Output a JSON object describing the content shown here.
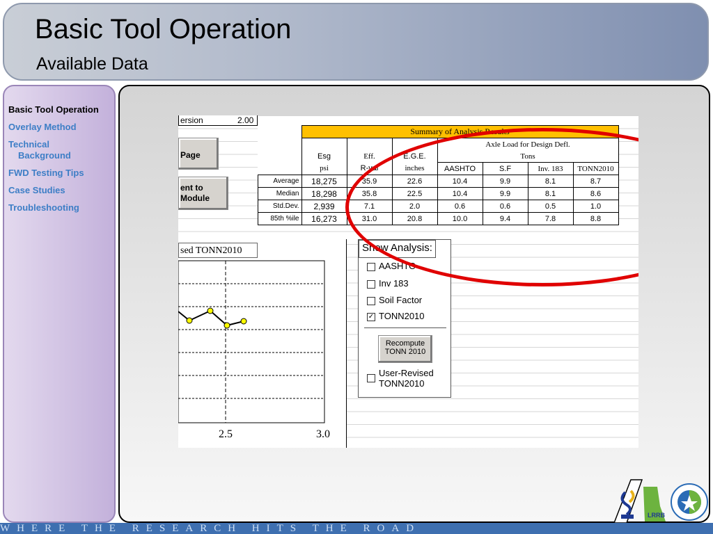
{
  "header": {
    "title": "Basic Tool Operation",
    "subtitle": "Available Data"
  },
  "sidebar": {
    "items": [
      {
        "label": "Basic Tool Operation",
        "active": true
      },
      {
        "label": "Overlay Method"
      },
      {
        "label": "Technical",
        "label2": "Background"
      },
      {
        "label": "FWD Testing Tips"
      },
      {
        "label": "Case Studies"
      },
      {
        "label": "Troubleshooting"
      }
    ]
  },
  "sheet": {
    "version_label": "ersion",
    "version_value": "2.00",
    "page_button": "Page",
    "module_button_line1": "ent to",
    "module_button_line2": "Module",
    "summary": {
      "band": "Summary of Analysis Results",
      "axle_header_line1": "Axle Load for Design Defl.",
      "axle_header_line2": "Tons",
      "col_names": [
        "Esg",
        "Eff.",
        "E.G.E."
      ],
      "col_units": [
        "psi",
        "R-val",
        "inches"
      ],
      "sub_cols": [
        "AASHTO",
        "S.F",
        "Inv. 183",
        "TONN2010"
      ],
      "rows": [
        {
          "label": "Average",
          "values": [
            "18,275",
            "35.9",
            "22.6",
            "10.4",
            "9.9",
            "8.1",
            "8.7"
          ]
        },
        {
          "label": "Median",
          "values": [
            "18,298",
            "35.8",
            "22.5",
            "10.4",
            "9.9",
            "8.1",
            "8.6"
          ]
        },
        {
          "label": "Std.Dev.",
          "values": [
            "2,939",
            "7.1",
            "2.0",
            "0.6",
            "0.6",
            "0.5",
            "1.0"
          ]
        },
        {
          "label": "85th %ile",
          "values": [
            "16,273",
            "31.0",
            "20.8",
            "10.0",
            "9.4",
            "7.8",
            "8.8"
          ]
        }
      ]
    },
    "chart_title": "sed TONN2010",
    "chart_ticks": [
      "2.5",
      "3.0"
    ],
    "show_analysis": {
      "title": "Show Analysis:",
      "options": [
        {
          "label": "AASHTO",
          "checked": false
        },
        {
          "label": "Inv 183",
          "checked": false
        },
        {
          "label": "Soil Factor",
          "checked": false
        },
        {
          "label": "TONN2010",
          "checked": true
        }
      ],
      "recompute_line1": "Recompute",
      "recompute_line2": "TONN 2010",
      "user_revised_line1": "User-Revised",
      "user_revised_line2": "TONN2010"
    }
  },
  "footer": "WHERE THE RESEARCH HITS THE ROAD",
  "logos": {
    "lrrb": "LRRB",
    "mndot": "MINNESOTA DEPARTMENT OF TRANSPORTATION"
  },
  "colors": {
    "accent_red": "#e00000",
    "band_yellow": "#ffc000",
    "footer_blue": "#3e6fb0"
  }
}
